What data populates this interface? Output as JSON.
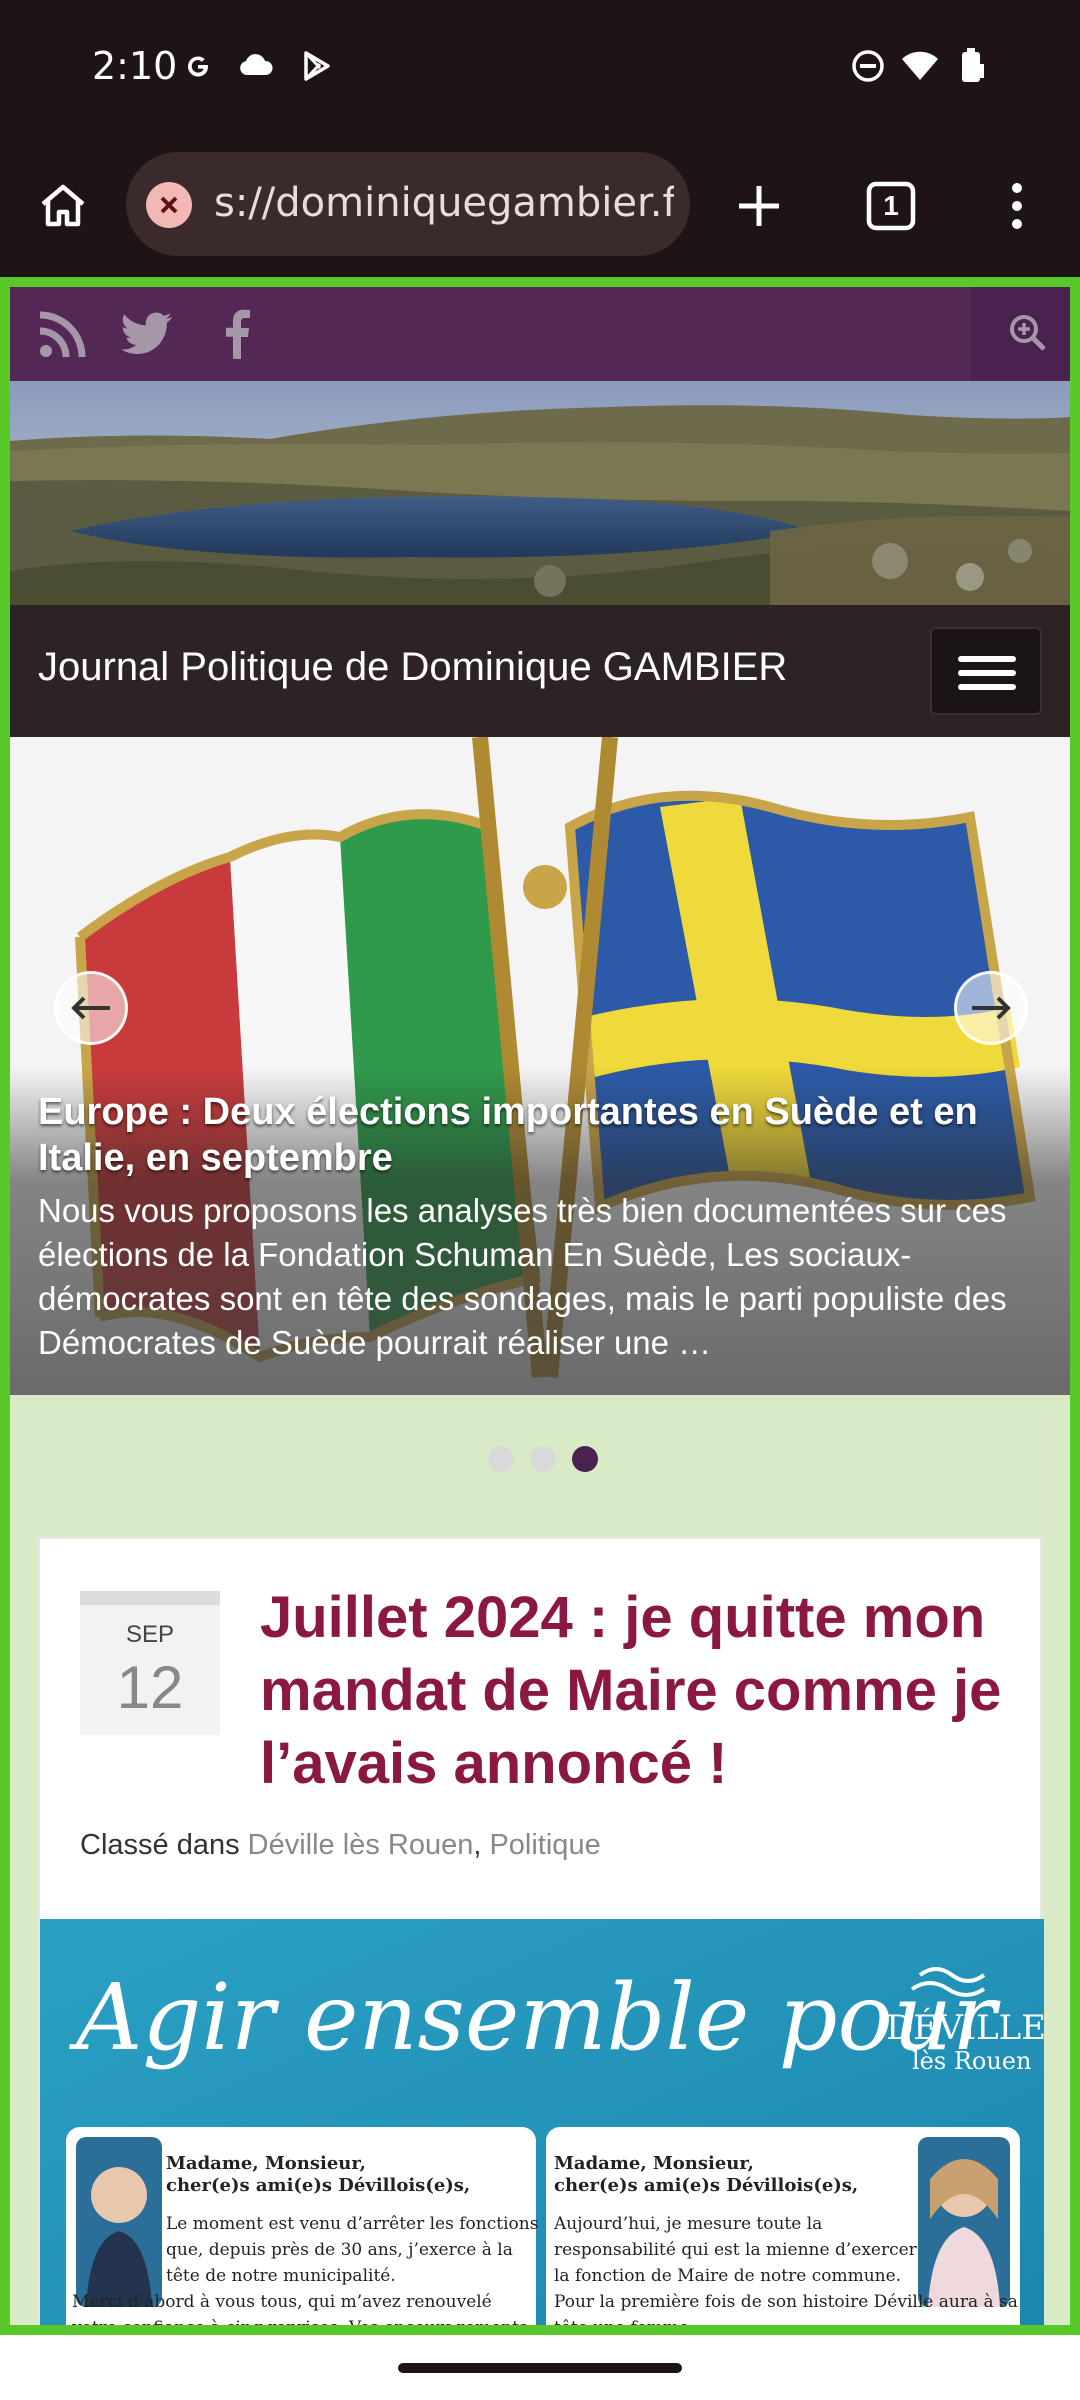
{
  "status": {
    "time": "2:10",
    "icons": [
      "google-icon",
      "cloud-icon",
      "play-store-icon",
      "dnd-icon",
      "wifi-icon",
      "battery-icon"
    ]
  },
  "browser": {
    "url": "s://dominiquegambier.fr",
    "tab_count": "1",
    "icons": [
      "home-icon",
      "security-warning-icon",
      "new-tab-icon",
      "tab-switcher-icon",
      "more-icon"
    ]
  },
  "site": {
    "social_icons": [
      "rss-icon",
      "twitter-icon",
      "facebook-icon"
    ],
    "title": "Journal Politique de Dominique GAMBIER"
  },
  "slider": {
    "title": "Europe : Deux élections importantes en Suède et en Italie, en septembre",
    "text": "Nous vous proposons les analyses très bien documentées sur ces élections de la Fondation Schuman En Suède, Les sociaux-démocrates sont en tête des sondages, mais le parti populiste des Démocrates de Suède pourrait réaliser une …",
    "dot_count": 3,
    "active_dot": 3
  },
  "post": {
    "month": "SEP",
    "day": "12",
    "title": "Juillet 2024 : je quitte mon mandat de Maire comme je l’avais annoncé !",
    "meta_label": "Classé dans",
    "categories": [
      "Déville lès Rouen",
      "Politique"
    ],
    "separator": ","
  },
  "flyer": {
    "headline": "Agir ensemble pour",
    "logo_name": "DÉVILLE",
    "logo_sub": "lès Rouen",
    "left": {
      "salutation1": "Madame, Monsieur,",
      "salutation2": "cher(e)s ami(e)s Dévillois(e)s,",
      "body1": "Le moment est venu d’arrêter les fonctions",
      "body2": "que, depuis près de 30 ans, j’exerce à la",
      "body3": "tête de notre municipalité.",
      "body4": "Merci d’abord à vous tous, qui m’avez renouvelé",
      "body5": "votre confiance à cinq reprises. Vos encouragements"
    },
    "right": {
      "salutation1": "Madame, Monsieur,",
      "salutation2": "cher(e)s ami(e)s Dévillois(e)s,",
      "body1": "Aujourd’hui, je mesure toute la",
      "body2": "responsabilité qui est la mienne d’exercer",
      "body3": "la fonction de Maire de notre commune.",
      "body4": "Pour la première fois de son histoire Déville aura à sa",
      "body5": "tête une femme."
    }
  },
  "colors": {
    "purple": "#532855",
    "title_red": "#8b1842",
    "green_border": "#59c92a",
    "page_bg": "#d9ebc6"
  }
}
